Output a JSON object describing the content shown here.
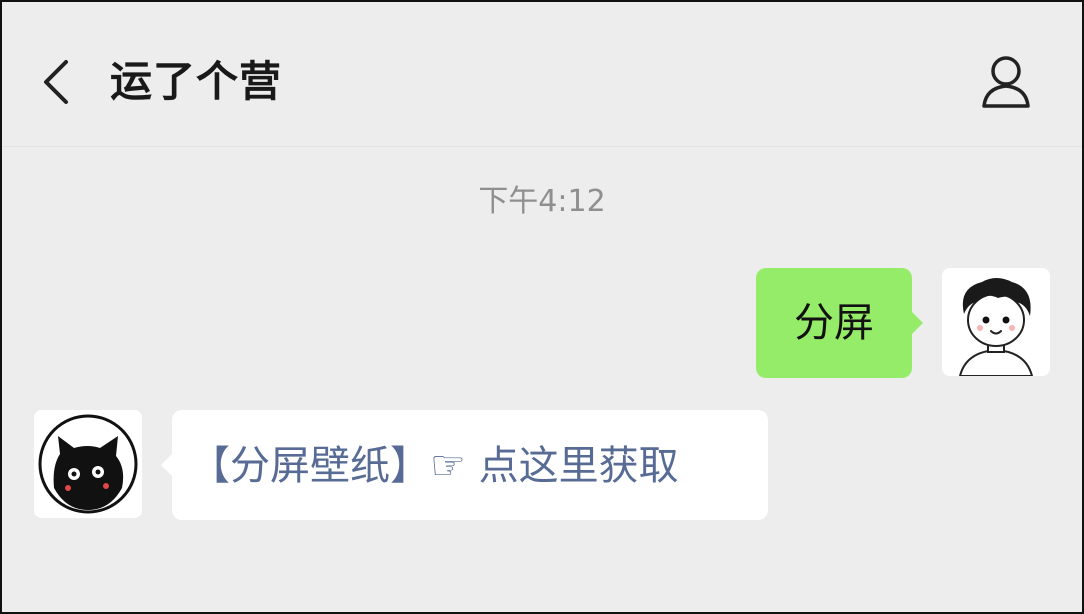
{
  "header": {
    "title": "运了个营",
    "back_icon": "chevron-left-icon",
    "profile_icon": "person-icon"
  },
  "chat": {
    "timestamp": "下午4:12",
    "messages": [
      {
        "sender": "me",
        "text": "分屏"
      },
      {
        "sender": "official-account",
        "text": "【分屏壁纸】☞ 点这里获取"
      }
    ]
  },
  "colors": {
    "background": "#ededed",
    "my_bubble": "#95ec69",
    "their_bubble": "#ffffff",
    "link_text": "#576b95",
    "timestamp_text": "#8f8f8f"
  }
}
